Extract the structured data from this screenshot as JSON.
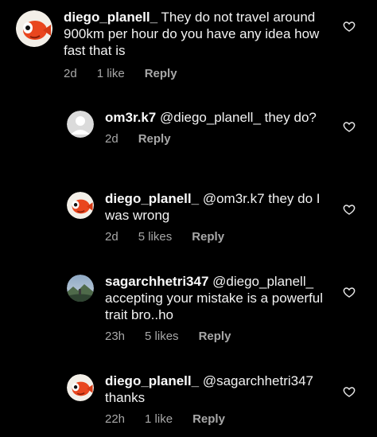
{
  "comments": [
    {
      "username": "diego_planell_",
      "text": "They do not travel around 900km per hour do you have any idea how fast that is",
      "time": "2d",
      "likes": "1 like",
      "reply_label": "Reply",
      "avatar": "fish-avatar"
    },
    {
      "username": "om3r.k7",
      "text": "@diego_planell_ they do?",
      "time": "2d",
      "likes": "",
      "reply_label": "Reply",
      "avatar": "default-avatar"
    },
    {
      "username": "diego_planell_",
      "text": "@om3r.k7 they do I was wrong",
      "time": "2d",
      "likes": "5 likes",
      "reply_label": "Reply",
      "avatar": "fish-avatar"
    },
    {
      "username": "sagarchhetri347",
      "text": "@diego_planell_ accepting your mistake is a powerful trait bro..ho",
      "time": "23h",
      "likes": "5 likes",
      "reply_label": "Reply",
      "avatar": "landscape-avatar"
    },
    {
      "username": "diego_planell_",
      "text": "@sagarchhetri347 thanks",
      "time": "22h",
      "likes": "1 like",
      "reply_label": "Reply",
      "avatar": "fish-avatar"
    }
  ]
}
